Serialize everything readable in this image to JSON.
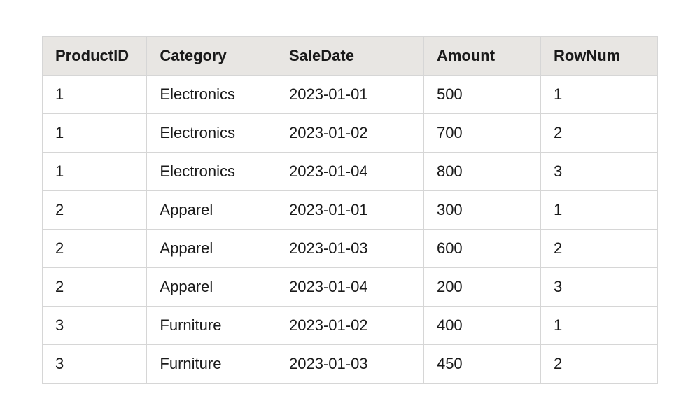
{
  "table": {
    "headers": {
      "productId": "ProductID",
      "category": "Category",
      "saleDate": "SaleDate",
      "amount": "Amount",
      "rowNum": "RowNum"
    },
    "rows": [
      {
        "productId": "1",
        "category": "Electronics",
        "saleDate": "2023-01-01",
        "amount": "500",
        "rowNum": "1"
      },
      {
        "productId": "1",
        "category": "Electronics",
        "saleDate": "2023-01-02",
        "amount": "700",
        "rowNum": "2"
      },
      {
        "productId": "1",
        "category": "Electronics",
        "saleDate": "2023-01-04",
        "amount": "800",
        "rowNum": "3"
      },
      {
        "productId": "2",
        "category": "Apparel",
        "saleDate": "2023-01-01",
        "amount": "300",
        "rowNum": "1"
      },
      {
        "productId": "2",
        "category": "Apparel",
        "saleDate": "2023-01-03",
        "amount": "600",
        "rowNum": "2"
      },
      {
        "productId": "2",
        "category": "Apparel",
        "saleDate": "2023-01-04",
        "amount": "200",
        "rowNum": "3"
      },
      {
        "productId": "3",
        "category": "Furniture",
        "saleDate": "2023-01-02",
        "amount": "400",
        "rowNum": "1"
      },
      {
        "productId": "3",
        "category": "Furniture",
        "saleDate": "2023-01-03",
        "amount": "450",
        "rowNum": "2"
      }
    ]
  }
}
